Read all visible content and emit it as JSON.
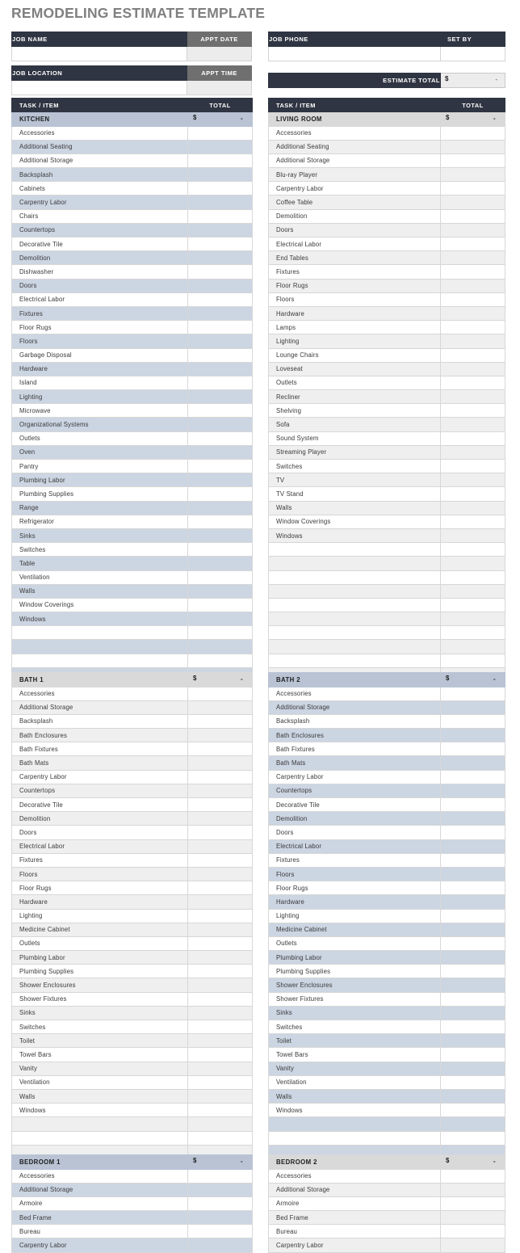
{
  "title": "REMODELING ESTIMATE TEMPLATE",
  "header": {
    "job_name_label": "JOB NAME",
    "job_name_value": "",
    "appt_date_label": "APPT DATE",
    "appt_date_value": "",
    "job_location_label": "JOB LOCATION",
    "job_location_value": "",
    "appt_time_label": "APPT TIME",
    "appt_time_value": "",
    "job_phone_label": "JOB PHONE",
    "job_phone_value": "",
    "set_by_label": "SET BY",
    "set_by_value": "",
    "estimate_total_label": "ESTIMATE TOTAL",
    "estimate_total_currency": "$",
    "estimate_total_value": "-"
  },
  "column_headers": {
    "task_item": "TASK / ITEM",
    "total": "TOTAL"
  },
  "currency_symbol": "$",
  "empty_total": "-",
  "colors": {
    "header_dark": "#2f3542",
    "header_gray": "#6f6f6f",
    "band_blue": "#ccd5e2",
    "section_blue": "#b9c3d4",
    "band_gray": "#efefef",
    "section_gray": "#d9d9d9",
    "title_text": "#808080"
  },
  "sections": [
    {
      "id": "kitchen",
      "name": "KITCHEN",
      "theme": "blue",
      "total_currency": "$",
      "total_value": "-",
      "show_column_header": true,
      "items": [
        "Accessories",
        "Additional Seating",
        "Additional Storage",
        "Backsplash",
        "Cabinets",
        "Carpentry Labor",
        "Chairs",
        "Countertops",
        "Decorative Tile",
        "Demolition",
        "Dishwasher",
        "Doors",
        "Electrical Labor",
        "Fixtures",
        "Floor Rugs",
        "Floors",
        "Garbage Disposal",
        "Hardware",
        "Island",
        "Lighting",
        "Microwave",
        "Organizational Systems",
        "Outlets",
        "Oven",
        "Pantry",
        "Plumbing Labor",
        "Plumbing Supplies",
        "Range",
        "Refrigerator",
        "Sinks",
        "Switches",
        "Table",
        "Ventilation",
        "Walls",
        "Window Coverings",
        "Windows"
      ],
      "blank_rows": 5
    },
    {
      "id": "living-room",
      "name": "LIVING ROOM",
      "theme": "gray",
      "total_currency": "$",
      "total_value": "-",
      "show_column_header": true,
      "items": [
        "Accessories",
        "Additional Seating",
        "Additional Storage",
        "Blu-ray Player",
        "Carpentry Labor",
        "Coffee Table",
        "Demolition",
        "Doors",
        "Electrical Labor",
        "End Tables",
        "Fixtures",
        "Floor Rugs",
        "Floors",
        "Hardware",
        "Lamps",
        "Lighting",
        "Lounge Chairs",
        "Loveseat",
        "Outlets",
        "Recliner",
        "Shelving",
        "Sofa",
        "Sound System",
        "Streaming Player",
        "Switches",
        "TV",
        "TV Stand",
        "Walls",
        "Window Coverings",
        "Windows"
      ],
      "blank_rows": 11
    },
    {
      "id": "bath-1",
      "name": "BATH 1",
      "theme": "gray",
      "total_currency": "$",
      "total_value": "-",
      "show_column_header": false,
      "items": [
        "Accessories",
        "Additional Storage",
        "Backsplash",
        "Bath Enclosures",
        "Bath Fixtures",
        "Bath Mats",
        "Carpentry Labor",
        "Countertops",
        "Decorative Tile",
        "Demolition",
        "Doors",
        "Electrical Labor",
        "Fixtures",
        "Floors",
        "Floor Rugs",
        "Hardware",
        "Lighting",
        "Medicine Cabinet",
        "Outlets",
        "Plumbing Labor",
        "Plumbing Supplies",
        "Shower Enclosures",
        "Shower Fixtures",
        "Sinks",
        "Switches",
        "Toilet",
        "Towel Bars",
        "Vanity",
        "Ventilation",
        "Walls",
        "Windows"
      ],
      "blank_rows": 4
    },
    {
      "id": "bath-2",
      "name": "BATH 2",
      "theme": "blue",
      "total_currency": "$",
      "total_value": "-",
      "show_column_header": false,
      "items": [
        "Accessories",
        "Additional Storage",
        "Backsplash",
        "Bath Enclosures",
        "Bath Fixtures",
        "Bath Mats",
        "Carpentry Labor",
        "Countertops",
        "Decorative Tile",
        "Demolition",
        "Doors",
        "Electrical Labor",
        "Fixtures",
        "Floors",
        "Floor Rugs",
        "Hardware",
        "Lighting",
        "Medicine Cabinet",
        "Outlets",
        "Plumbing Labor",
        "Plumbing Supplies",
        "Shower Enclosures",
        "Shower Fixtures",
        "Sinks",
        "Switches",
        "Toilet",
        "Towel Bars",
        "Vanity",
        "Ventilation",
        "Walls",
        "Windows"
      ],
      "blank_rows": 4
    },
    {
      "id": "bedroom-1",
      "name": "BEDROOM 1",
      "theme": "blue",
      "total_currency": "$",
      "total_value": "-",
      "show_column_header": false,
      "items": [
        "Accessories",
        "Additional Storage",
        "Armoire",
        "Bed Frame",
        "Bureau",
        "Carpentry Labor"
      ],
      "blank_rows": 0
    },
    {
      "id": "bedroom-2",
      "name": "BEDROOM 2",
      "theme": "gray",
      "total_currency": "$",
      "total_value": "-",
      "show_column_header": false,
      "items": [
        "Accessories",
        "Additional Storage",
        "Armoire",
        "Bed Frame",
        "Bureau",
        "Carpentry Labor"
      ],
      "blank_rows": 0
    }
  ]
}
